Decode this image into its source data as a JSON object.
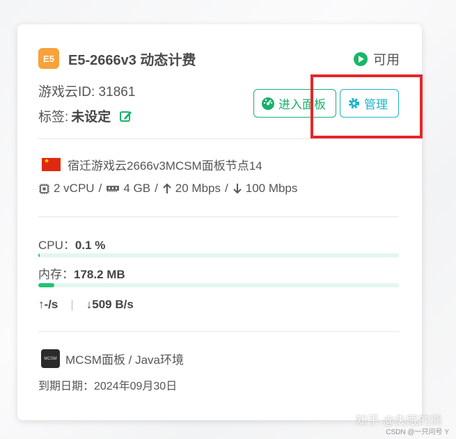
{
  "server": {
    "badge": "E5",
    "title": "E5-2666v3 动态计费",
    "status": "可用",
    "game_id": "游戏云ID: 31861",
    "tag_label": "标签:",
    "tag_value": "未设定"
  },
  "buttons": {
    "panel": "进入面板",
    "manage": "管理"
  },
  "node": {
    "location": "宿迁游戏云2666v3MCSM面板节点14",
    "cpu": "2 vCPU",
    "ram": "4 GB",
    "up": "20 Mbps",
    "down": "100 Mbps"
  },
  "usage": {
    "cpu_label": "CPU：",
    "cpu_value": "0.1 %",
    "cpu_fraction": 0.001,
    "mem_label": "内存：",
    "mem_value": "178.2 MB",
    "mem_fraction": 0.044,
    "net_up": "↑-/s",
    "net_sep": "|",
    "net_down": "↓509 B/s"
  },
  "app": {
    "logo_text": "MCSM",
    "name": "MCSM面板 / Java环境",
    "expiry": "到期日期：2024年09月30日"
  },
  "watermark": {
    "main": "知乎 @失眠的熊",
    "sub": "CSDN @一只问号 Y"
  },
  "colors": {
    "accent_green": "#19b16b",
    "accent_cyan": "#1fb3c9",
    "badge_orange": "#f7a23b",
    "highlight_red": "#e5262b"
  }
}
